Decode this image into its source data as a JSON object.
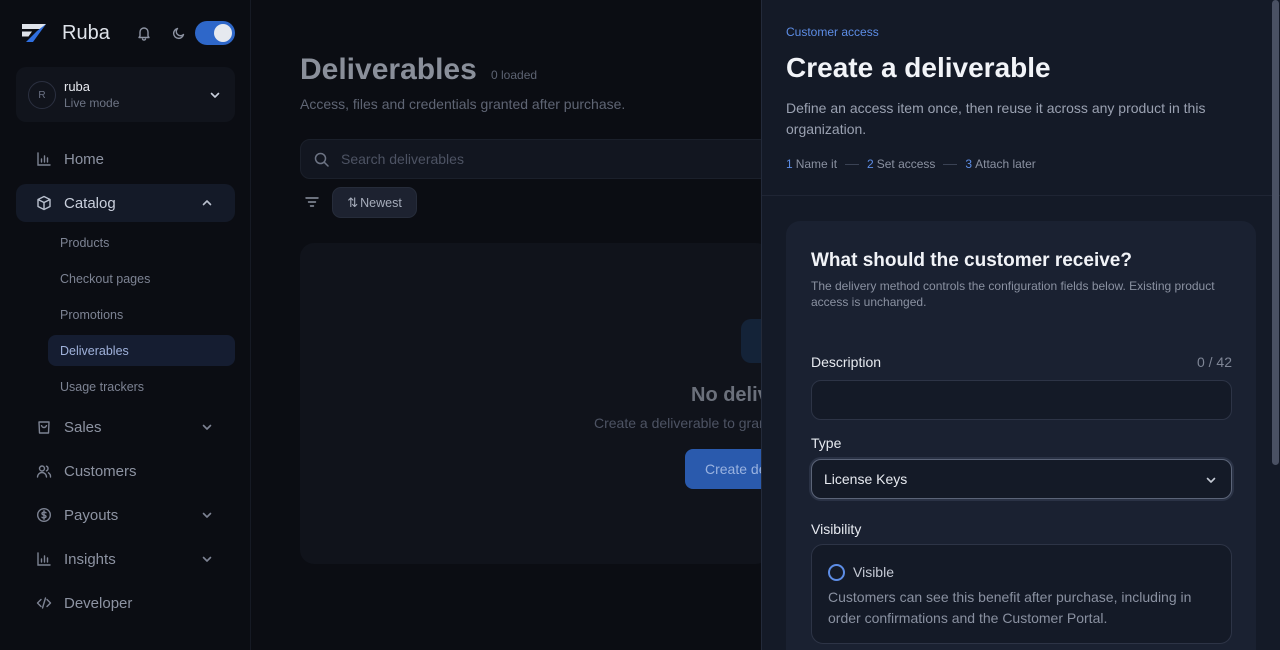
{
  "app": {
    "name": "Ruba"
  },
  "org": {
    "avatar_initial": "R",
    "name": "ruba",
    "mode": "Live mode"
  },
  "nav": {
    "home": "Home",
    "catalog": "Catalog",
    "catalog_children": [
      "Products",
      "Checkout pages",
      "Promotions",
      "Deliverables",
      "Usage trackers"
    ],
    "sales": "Sales",
    "customers": "Customers",
    "payouts": "Payouts",
    "insights": "Insights",
    "developer": "Developer"
  },
  "main": {
    "title": "Deliverables",
    "loaded": "0 loaded",
    "subtitle": "Access, files and credentials granted after purchase.",
    "search_placeholder": "Search deliverables",
    "sort_label": "Newest",
    "empty_title": "No deliverables yet",
    "empty_desc": "Create a deliverable to grant access after purchase.",
    "empty_cta": "Create deliverable"
  },
  "drawer": {
    "eyebrow": "Customer access",
    "title": "Create a deliverable",
    "description": "Define an access item once, then reuse it across any product in this organization.",
    "steps": [
      {
        "num": "1",
        "label": "Name it"
      },
      {
        "num": "2",
        "label": "Set access"
      },
      {
        "num": "3",
        "label": "Attach later"
      }
    ],
    "card": {
      "heading": "What should the customer receive?",
      "help": "The delivery method controls the configuration fields below. Existing product access is unchanged.",
      "description_label": "Description",
      "description_counter": "0 / 42",
      "description_value": "",
      "type_label": "Type",
      "type_value": "License Keys",
      "visibility_label": "Visibility",
      "visibility_option": "Visible",
      "visibility_desc": "Customers can see this benefit after purchase, including in order confirmations and the Customer Portal."
    }
  },
  "colors": {
    "accent": "#2e67c9",
    "link": "#5d8de5"
  }
}
